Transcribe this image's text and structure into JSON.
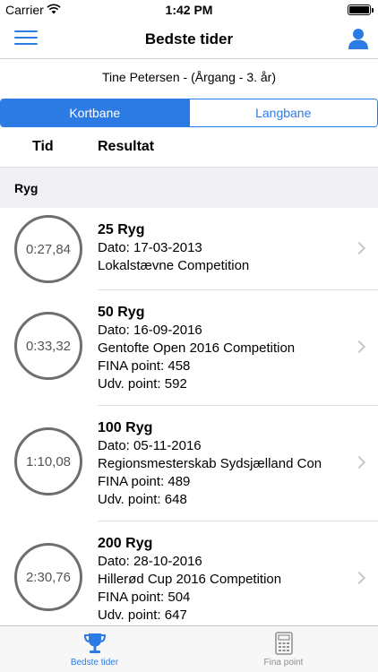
{
  "status_bar": {
    "carrier": "Carrier",
    "time": "1:42 PM"
  },
  "nav": {
    "title": "Bedste tider"
  },
  "swimmer": "Tine Petersen - (Årgang - 3. år)",
  "segments": {
    "left": "Kortbane",
    "right": "Langbane",
    "selected": "Kortbane"
  },
  "table_header": {
    "tid": "Tid",
    "resultat": "Resultat"
  },
  "section": {
    "title": "Ryg"
  },
  "results": [
    {
      "time": "0:27,84",
      "event": "25 Ryg",
      "date": "Dato: 17-03-2013",
      "competition": "Lokalstævne Competition"
    },
    {
      "time": "0:33,32",
      "event": "50 Ryg",
      "date": "Dato: 16-09-2016",
      "competition": "Gentofte Open 2016 Competition",
      "fina": "FINA point: 458",
      "udv": "Udv. point: 592"
    },
    {
      "time": "1:10,08",
      "event": "100 Ryg",
      "date": "Dato: 05-11-2016",
      "competition": "Regionsmesterskab Sydsjælland Con",
      "fina": "FINA point: 489",
      "udv": "Udv. point: 648"
    },
    {
      "time": "2:30,76",
      "event": "200 Ryg",
      "date": "Dato: 28-10-2016",
      "competition": "Hillerød Cup 2016 Competition",
      "fina": "FINA point: 504",
      "udv": "Udv. point: 647"
    }
  ],
  "tabs": [
    {
      "label": "Bedste tider",
      "icon": "trophy-icon",
      "active": true
    },
    {
      "label": "Fina point",
      "icon": "calculator-icon",
      "active": false
    }
  ],
  "colors": {
    "accent": "#2c7be5",
    "section_bg": "#efeff4",
    "circle": "#6e6e6e"
  }
}
